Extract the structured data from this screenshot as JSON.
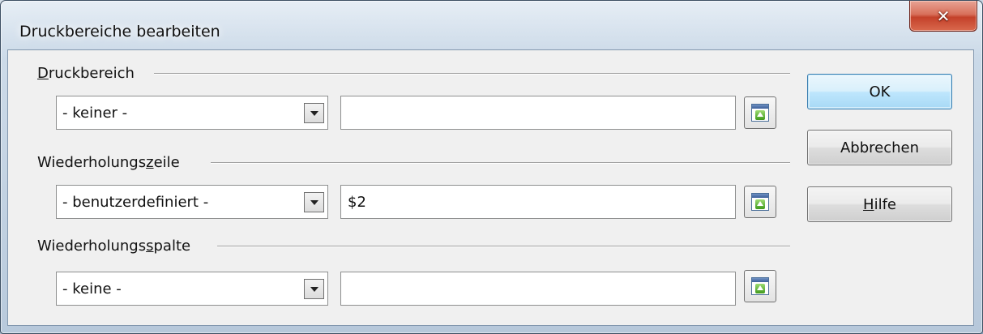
{
  "window": {
    "title": "Druckbereiche bearbeiten",
    "close_glyph": "✕"
  },
  "sections": [
    {
      "label_pre": "",
      "label_mnemonic": "D",
      "label_post": "ruckbereich",
      "combo_value": "- keiner -",
      "field_value": ""
    },
    {
      "label_pre": "Wiederholungs",
      "label_mnemonic": "z",
      "label_post": "eile",
      "combo_value": "- benutzerdefiniert -",
      "field_value": "$2"
    },
    {
      "label_pre": "Wiederholungs",
      "label_mnemonic": "s",
      "label_post": "palte",
      "combo_value": "- keine -",
      "field_value": ""
    }
  ],
  "buttons": {
    "ok": "OK",
    "cancel": "Abbrechen",
    "help_mnemonic": "H",
    "help_rest": "ilfe"
  },
  "icons": {
    "close": "close-icon",
    "dropdown": "chevron-down-icon",
    "shrink": "shrink-dialog-icon"
  }
}
